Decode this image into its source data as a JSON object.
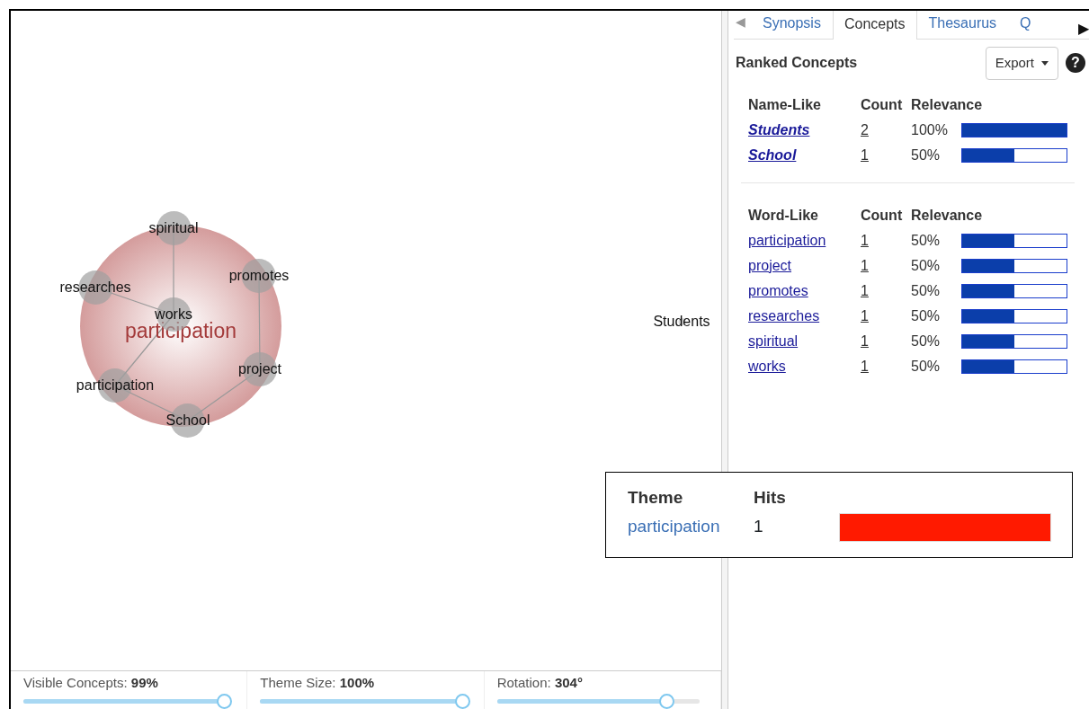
{
  "map": {
    "theme": {
      "label": "participation"
    },
    "nodes": [
      {
        "label": "spiritual"
      },
      {
        "label": "promotes"
      },
      {
        "label": "researches"
      },
      {
        "label": "works"
      },
      {
        "label": "project"
      },
      {
        "label": "participation"
      },
      {
        "label": "School"
      }
    ],
    "orphans": [
      {
        "label": "Students"
      }
    ]
  },
  "sliders": [
    {
      "label": "Visible Concepts:",
      "value": "99%",
      "level": 0.99
    },
    {
      "label": "Theme Size:",
      "value": "100%",
      "level": 1.0
    },
    {
      "label": "Rotation:",
      "value": "304°",
      "level": 0.84
    }
  ],
  "tab_scroll": {
    "left": "◀",
    "right": "▶"
  },
  "tabs": [
    {
      "label": "Synopsis",
      "selected": false
    },
    {
      "label": "Concepts",
      "selected": true
    },
    {
      "label": "Thesaurus",
      "selected": false
    },
    {
      "label": "Q",
      "selected": false
    }
  ],
  "panel": {
    "title": "Ranked Concepts",
    "export_button": "Export",
    "help": "?",
    "groups": [
      {
        "kind": "name",
        "heading": "Name-Like",
        "count_heading": "Count",
        "relevance_heading": "Relevance",
        "rows": [
          {
            "name": "Students",
            "count": "2",
            "percent": "100%",
            "level": 1.0
          },
          {
            "name": "School",
            "count": "1",
            "percent": "50%",
            "level": 0.5
          }
        ]
      },
      {
        "kind": "word",
        "heading": "Word-Like",
        "count_heading": "Count",
        "relevance_heading": "Relevance",
        "rows": [
          {
            "name": "participation",
            "count": "1",
            "percent": "50%",
            "level": 0.5
          },
          {
            "name": "project",
            "count": "1",
            "percent": "50%",
            "level": 0.5
          },
          {
            "name": "promotes",
            "count": "1",
            "percent": "50%",
            "level": 0.5
          },
          {
            "name": "researches",
            "count": "1",
            "percent": "50%",
            "level": 0.5
          },
          {
            "name": "spiritual",
            "count": "1",
            "percent": "50%",
            "level": 0.5
          },
          {
            "name": "works",
            "count": "1",
            "percent": "50%",
            "level": 0.5
          }
        ]
      }
    ]
  },
  "tooltip": {
    "theme_heading": "Theme",
    "hits_heading": "Hits",
    "theme": "participation",
    "hits": "1",
    "color": "#ff1a00"
  }
}
